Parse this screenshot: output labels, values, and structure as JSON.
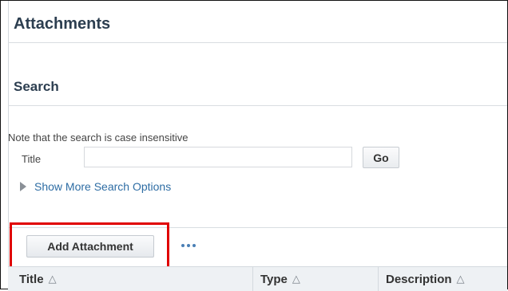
{
  "page": {
    "title": "Attachments"
  },
  "search": {
    "section_title": "Search",
    "note": "Note that the search is case insensitive",
    "title_label": "Title",
    "title_value": "",
    "go_label": "Go",
    "more_options_label": "Show More Search Options"
  },
  "toolbar": {
    "add_attachment_label": "Add Attachment",
    "more_actions_icon": "ellipsis-icon"
  },
  "table": {
    "columns": [
      {
        "label": "Title",
        "sort_icon": "sort-ascending-icon"
      },
      {
        "label": "Type",
        "sort_icon": "sort-ascending-icon"
      },
      {
        "label": "Description",
        "sort_icon": "sort-ascending-icon"
      }
    ]
  },
  "colors": {
    "highlight": "#e00000",
    "link": "#2e6da4",
    "heading": "#2c3e50"
  }
}
